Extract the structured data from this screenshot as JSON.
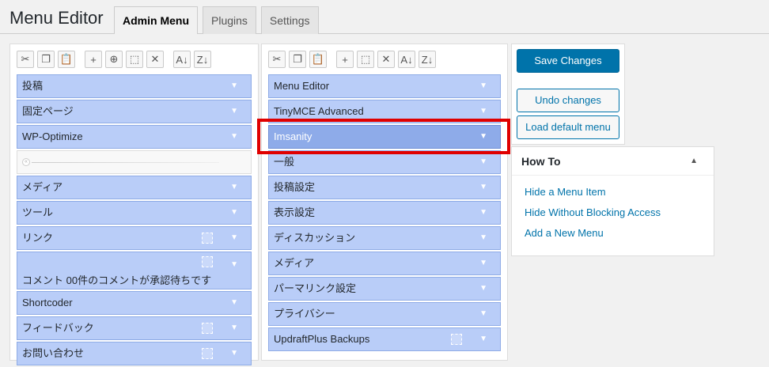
{
  "header": {
    "title": "Menu Editor",
    "tabs": [
      {
        "label": "Admin Menu"
      },
      {
        "label": "Plugins"
      },
      {
        "label": "Settings"
      }
    ]
  },
  "toolbar_icons": {
    "cut": "✂",
    "copy": "❐",
    "paste": "📋",
    "new_menu": "+",
    "new_separator": "⊕",
    "hide": "⬚",
    "delete": "✕",
    "sort_asc": "A↓",
    "sort_desc": "Z↓"
  },
  "left_menu": {
    "items": [
      {
        "label": "投稿"
      },
      {
        "label": "固定ページ"
      },
      {
        "label": "WP-Optimize"
      },
      {
        "label": ""
      },
      {
        "label": "メディア"
      },
      {
        "label": "ツール"
      },
      {
        "label": "リンク"
      },
      {
        "label": "コメント 00件のコメントが承認待ちです"
      },
      {
        "label": "Shortcoder"
      },
      {
        "label": "フィードバック"
      },
      {
        "label": "お問い合わせ"
      }
    ]
  },
  "right_menu": {
    "items": [
      {
        "label": "Menu Editor"
      },
      {
        "label": "TinyMCE Advanced"
      },
      {
        "label": "Imsanity"
      },
      {
        "label": "一般"
      },
      {
        "label": "投稿設定"
      },
      {
        "label": "表示設定"
      },
      {
        "label": "ディスカッション"
      },
      {
        "label": "メディア"
      },
      {
        "label": "パーマリンク設定"
      },
      {
        "label": "プライバシー"
      },
      {
        "label": "UpdraftPlus Backups"
      }
    ]
  },
  "actions": {
    "save": "Save Changes",
    "undo": "Undo changes",
    "load_default": "Load default menu"
  },
  "howto": {
    "title": "How To",
    "links": [
      {
        "label": "Hide a Menu Item"
      },
      {
        "label": "Hide Without Blocking Access"
      },
      {
        "label": "Add a New Menu"
      }
    ]
  },
  "colors": {
    "item_bg": "#b9cdf8",
    "item_selected_bg": "#8eabe9",
    "highlight": "#e00000",
    "primary": "#0073aa"
  }
}
